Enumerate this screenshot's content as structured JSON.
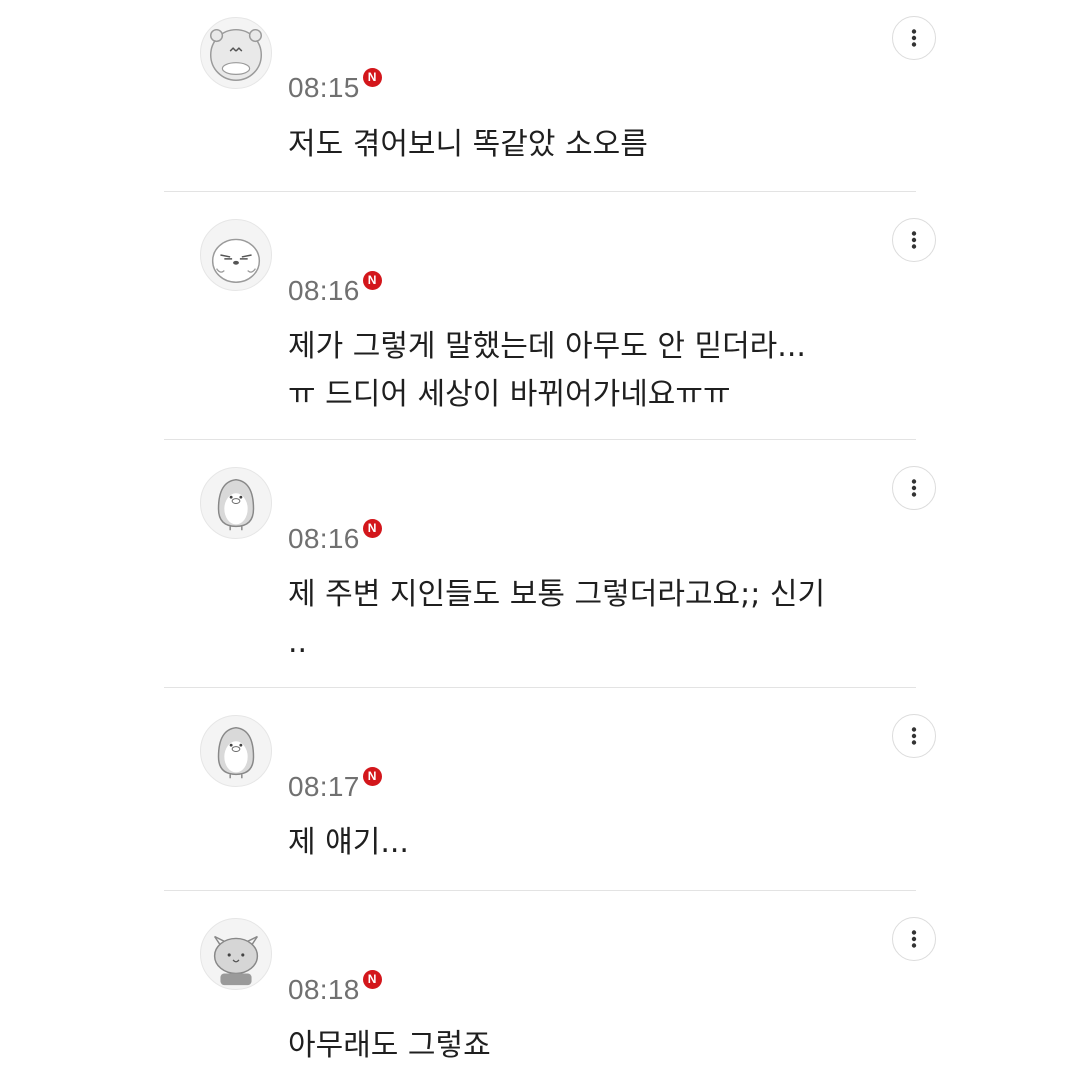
{
  "comments": [
    {
      "avatar": "hamster-avatar-icon",
      "time": "08:15",
      "badge": "N",
      "text": "저도 겪어보니 똑같았 소오름"
    },
    {
      "avatar": "seal-avatar-icon",
      "time": "08:16",
      "badge": "N",
      "text": "제가 그렇게 말했는데 아무도 안 믿더라...\nㅠ 드디어 세상이 바뀌어가네요ㅠㅠ"
    },
    {
      "avatar": "penguin-avatar-icon",
      "time": "08:16",
      "badge": "N",
      "text": "제 주변 지인들도 보통 그렇더라고요;; 신기\n.."
    },
    {
      "avatar": "penguin-avatar-icon",
      "time": "08:17",
      "badge": "N",
      "text": "제 얘기..."
    },
    {
      "avatar": "cat-avatar-icon",
      "time": "08:18",
      "badge": "N",
      "text": "아무래도 그렇죠"
    }
  ],
  "colors": {
    "badge": "#d3161b",
    "time": "#707070",
    "divider": "#e3e3e3"
  }
}
